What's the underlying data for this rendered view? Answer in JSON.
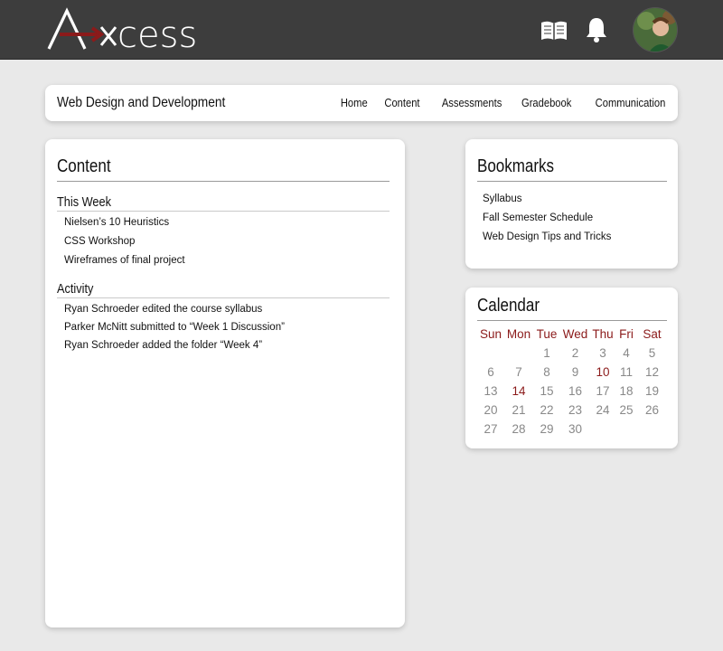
{
  "app": {
    "logo_text": "Axcess",
    "colors": {
      "topbar": "#3d3d3d",
      "accent": "#8b1a1a",
      "background": "#e9e9e9",
      "muted_day": "#888888"
    }
  },
  "header": {
    "icons": [
      "book-icon",
      "bell-icon"
    ],
    "avatar": "user-avatar"
  },
  "course": {
    "title": "Web Design and Development",
    "nav": [
      "Home",
      "Content",
      "Assessments",
      "Gradebook",
      "Communication"
    ]
  },
  "content": {
    "title": "Content",
    "this_week": {
      "heading": "This Week",
      "items": [
        "Nielsen’s 10 Heuristics",
        "CSS Workshop",
        "Wireframes of final project"
      ]
    },
    "activity": {
      "heading": "Activity",
      "items": [
        "Ryan Schroeder edited the course syllabus",
        "Parker McNitt submitted to “Week 1 Discussion”",
        "Ryan Schroeder added the folder “Week 4”"
      ]
    }
  },
  "bookmarks": {
    "title": "Bookmarks",
    "items": [
      "Syllabus",
      "Fall Semester Schedule",
      "Web Design Tips and Tricks"
    ]
  },
  "calendar": {
    "title": "Calendar",
    "weekdays": [
      "Sun",
      "Mon",
      "Tue",
      "Wed",
      "Thu",
      "Fri",
      "Sat"
    ],
    "days": [
      "",
      "",
      "1",
      "2",
      "3",
      "4",
      "5",
      "6",
      "7",
      "8",
      "9",
      "10",
      "11",
      "12",
      "13",
      "14",
      "15",
      "16",
      "17",
      "18",
      "19",
      "20",
      "21",
      "22",
      "23",
      "24",
      "25",
      "26",
      "27",
      "28",
      "29",
      "30",
      "",
      "",
      ""
    ],
    "highlighted": [
      "10",
      "14"
    ]
  }
}
